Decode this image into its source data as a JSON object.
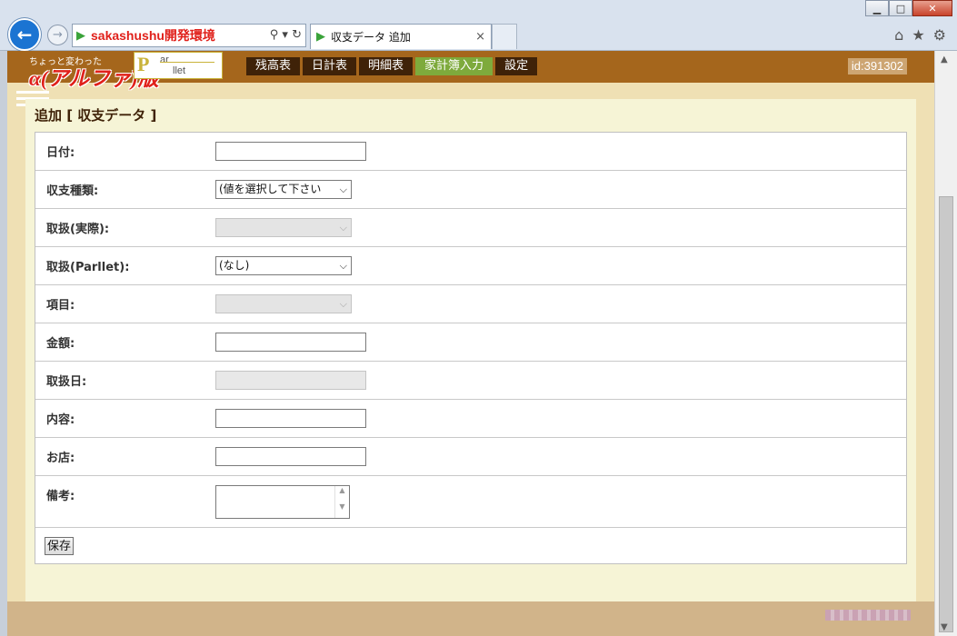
{
  "browser": {
    "address": "sakashushu開発環境",
    "tab_title": "収支データ 追加",
    "tab_close": "×",
    "back_glyph": "←",
    "forward_glyph": "→",
    "win_min": "▁",
    "win_max": "□",
    "win_close": "✕",
    "addr_tools": "⚲ ▾ ↻",
    "home_glyph": "⌂",
    "fav_glyph": "★",
    "settings_glyph": "⚙"
  },
  "header": {
    "logo_small": "ちょっと変わった",
    "logo_big": "α(アルファ)版",
    "parllet_p": "P",
    "parllet_top": "ar",
    "parllet_bottom": "llet",
    "nav": [
      {
        "label": "残高表",
        "active": false
      },
      {
        "label": "日計表",
        "active": false
      },
      {
        "label": "明細表",
        "active": false
      },
      {
        "label": "家計簿入力",
        "active": true
      },
      {
        "label": "設定",
        "active": false
      }
    ],
    "user_id": "id:391302"
  },
  "panel": {
    "title": "追加 [ 収支データ ]"
  },
  "form": {
    "date_label": "日付:",
    "date_value": "",
    "type_label": "収支種類:",
    "type_value": "(値を選択して下さい",
    "actual_label": "取扱(実際):",
    "actual_value": "",
    "parllet_label": "取扱(Parllet):",
    "parllet_value": "(なし)",
    "item_label": "項目:",
    "item_value": "",
    "amount_label": "金額:",
    "amount_value": "",
    "handle_date_label": "取扱日:",
    "handle_date_value": "",
    "content_label": "内容:",
    "content_value": "",
    "shop_label": "お店:",
    "shop_value": "",
    "note_label": "備考:",
    "note_value": "",
    "save_label": "保存"
  }
}
